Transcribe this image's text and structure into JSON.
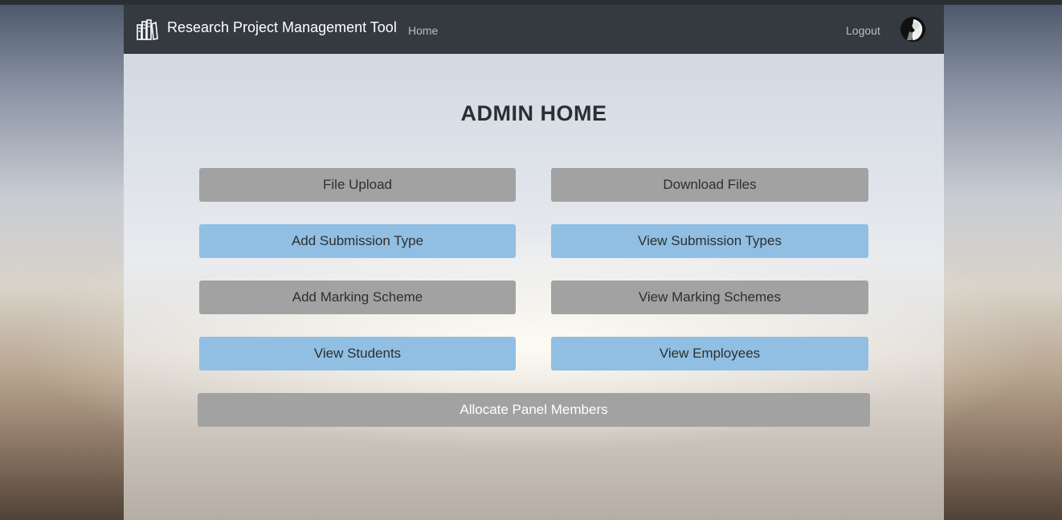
{
  "navbar": {
    "brand_title": "Research Project Management Tool",
    "home_link": "Home",
    "logout_link": "Logout",
    "brand_icon": "library-books-icon",
    "avatar_icon": "user-avatar"
  },
  "main": {
    "title": "ADMIN HOME",
    "buttons": {
      "file_upload": "File Upload",
      "download_files": "Download Files",
      "add_submission_type": "Add Submission Type",
      "view_submission_types": "View Submission Types",
      "add_marking_scheme": "Add Marking Scheme",
      "view_marking_schemes": "View Marking Schemes",
      "view_students": "View Students",
      "view_employees": "View Employees",
      "allocate_panel_members": "Allocate Panel Members"
    }
  },
  "colors": {
    "navbar_bg": "#343a40",
    "button_gray": "#a2a2a2",
    "button_blue": "#90bfe3"
  }
}
